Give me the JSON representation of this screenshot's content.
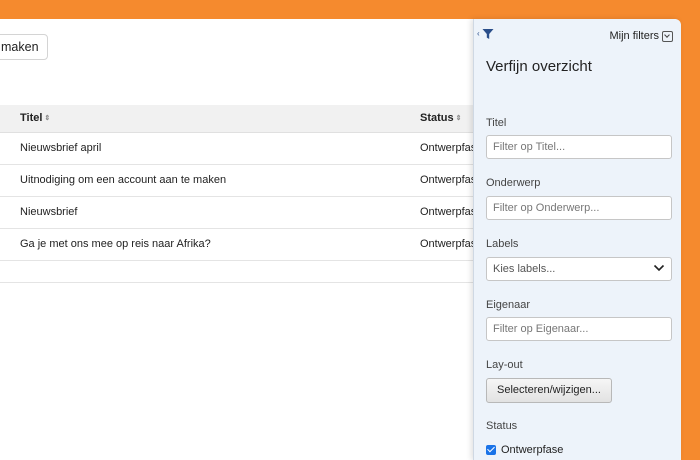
{
  "toolbar": {
    "create_label": "maken"
  },
  "table": {
    "columns": [
      {
        "label": "Titel",
        "sort_icon": "⇕"
      },
      {
        "label": "Status",
        "sort_icon": "⇕"
      }
    ],
    "rows": [
      {
        "title": "Nieuwsbrief april",
        "status": "Ontwerpfase"
      },
      {
        "title": "Uitnodiging om een account aan te maken",
        "status": "Ontwerpfase"
      },
      {
        "title": "Nieuwsbrief",
        "status": "Ontwerpfase"
      },
      {
        "title": "Ga je met ons mee op reis naar Afrika?",
        "status": "Ontwerpfase"
      }
    ]
  },
  "filter_panel": {
    "my_filters_label": "Mijn filters",
    "title": "Verfijn overzicht",
    "fields": {
      "title": {
        "label": "Titel",
        "placeholder": "Filter op Titel..."
      },
      "subject": {
        "label": "Onderwerp",
        "placeholder": "Filter op Onderwerp..."
      },
      "labels": {
        "label": "Labels",
        "placeholder": "Kies labels..."
      },
      "owner": {
        "label": "Eigenaar",
        "placeholder": "Filter op Eigenaar..."
      },
      "layout": {
        "label": "Lay-out",
        "button_label": "Selecteren/wijzigen..."
      },
      "status": {
        "label": "Status",
        "options": [
          {
            "label": "Ontwerpfase",
            "checked": true
          }
        ]
      }
    }
  },
  "colors": {
    "background": "#f58a2e",
    "filter_panel_bg": "#edf3fa",
    "accent": "#1a73e8",
    "icon": "#2a4e8a"
  },
  "icons": {
    "funnel": "funnel-icon",
    "collapse": "chevron-left-icon",
    "my_filters_dropdown": "chevron-down-icon",
    "sort": "sort-icon",
    "select_chevron": "chevron-down-icon"
  }
}
